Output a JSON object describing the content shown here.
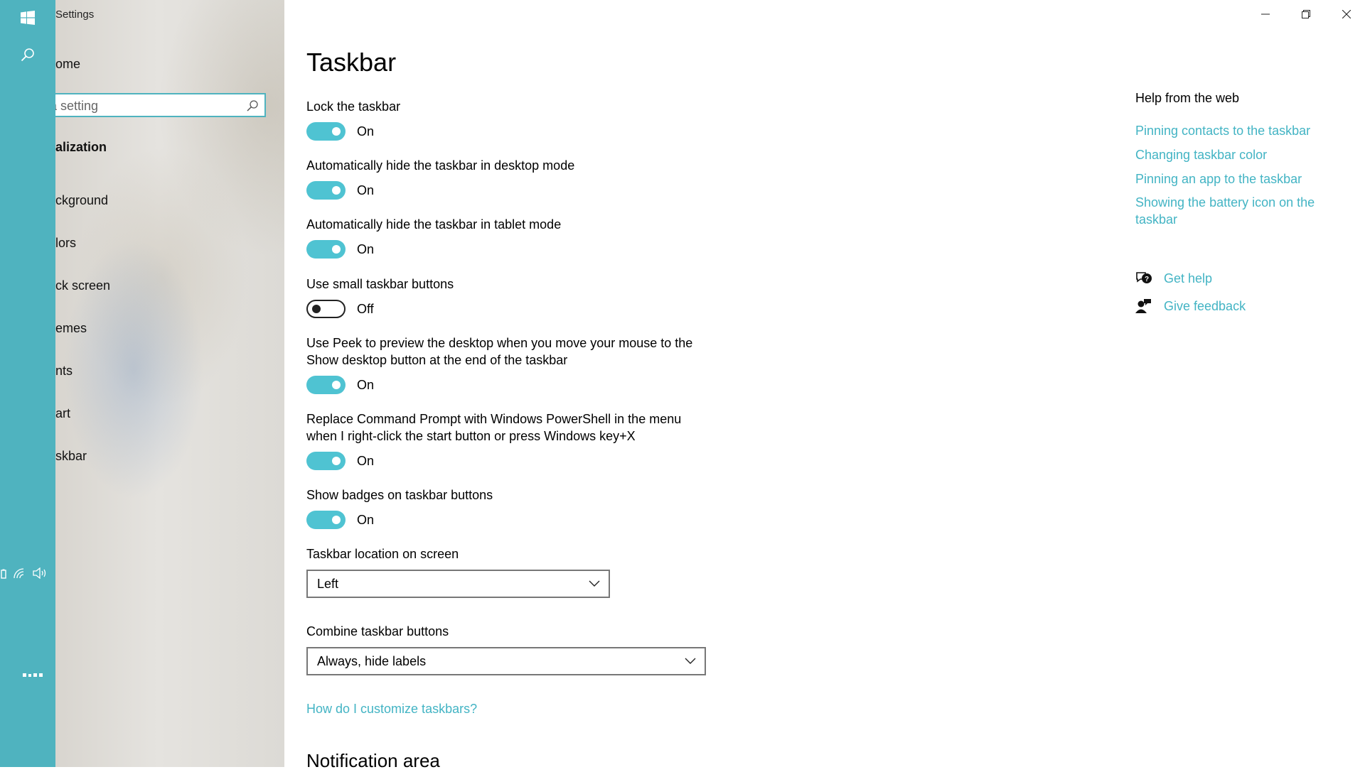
{
  "window": {
    "app_title": "Settings"
  },
  "nav": {
    "home": "ome",
    "search_placeholder": "a setting",
    "section": "alization",
    "items": [
      "ckground",
      "lors",
      "ck screen",
      "emes",
      "nts",
      "art",
      "skbar"
    ]
  },
  "page": {
    "title": "Taskbar"
  },
  "settings": {
    "lock": {
      "label": "Lock the taskbar",
      "state": "On"
    },
    "autohide_desktop": {
      "label": "Automatically hide the taskbar in desktop mode",
      "state": "On"
    },
    "autohide_tablet": {
      "label": "Automatically hide the taskbar in tablet mode",
      "state": "On"
    },
    "small_buttons": {
      "label": "Use small taskbar buttons",
      "state": "Off"
    },
    "peek": {
      "label": "Use Peek to preview the desktop when you move your mouse to the Show desktop button at the end of the taskbar",
      "state": "On"
    },
    "powershell": {
      "label": "Replace Command Prompt with Windows PowerShell in the menu when I right-click the start button or press Windows key+X",
      "state": "On"
    },
    "badges": {
      "label": "Show badges on taskbar buttons",
      "state": "On"
    },
    "location": {
      "label": "Taskbar location on screen",
      "value": "Left"
    },
    "combine": {
      "label": "Combine taskbar buttons",
      "value": "Always, hide labels"
    },
    "customize_link": "How do I customize taskbars?"
  },
  "notification_area": {
    "title": "Notification area"
  },
  "help": {
    "heading": "Help from the web",
    "links": [
      "Pinning contacts to the taskbar",
      "Changing taskbar color",
      "Pinning an app to the taskbar",
      "Showing the battery icon on the taskbar"
    ],
    "get_help": "Get help",
    "give_feedback": "Give feedback"
  },
  "colors": {
    "accent": "#4fc3d2",
    "taskbar": "#4fb3bf",
    "link": "#43b4c4"
  }
}
